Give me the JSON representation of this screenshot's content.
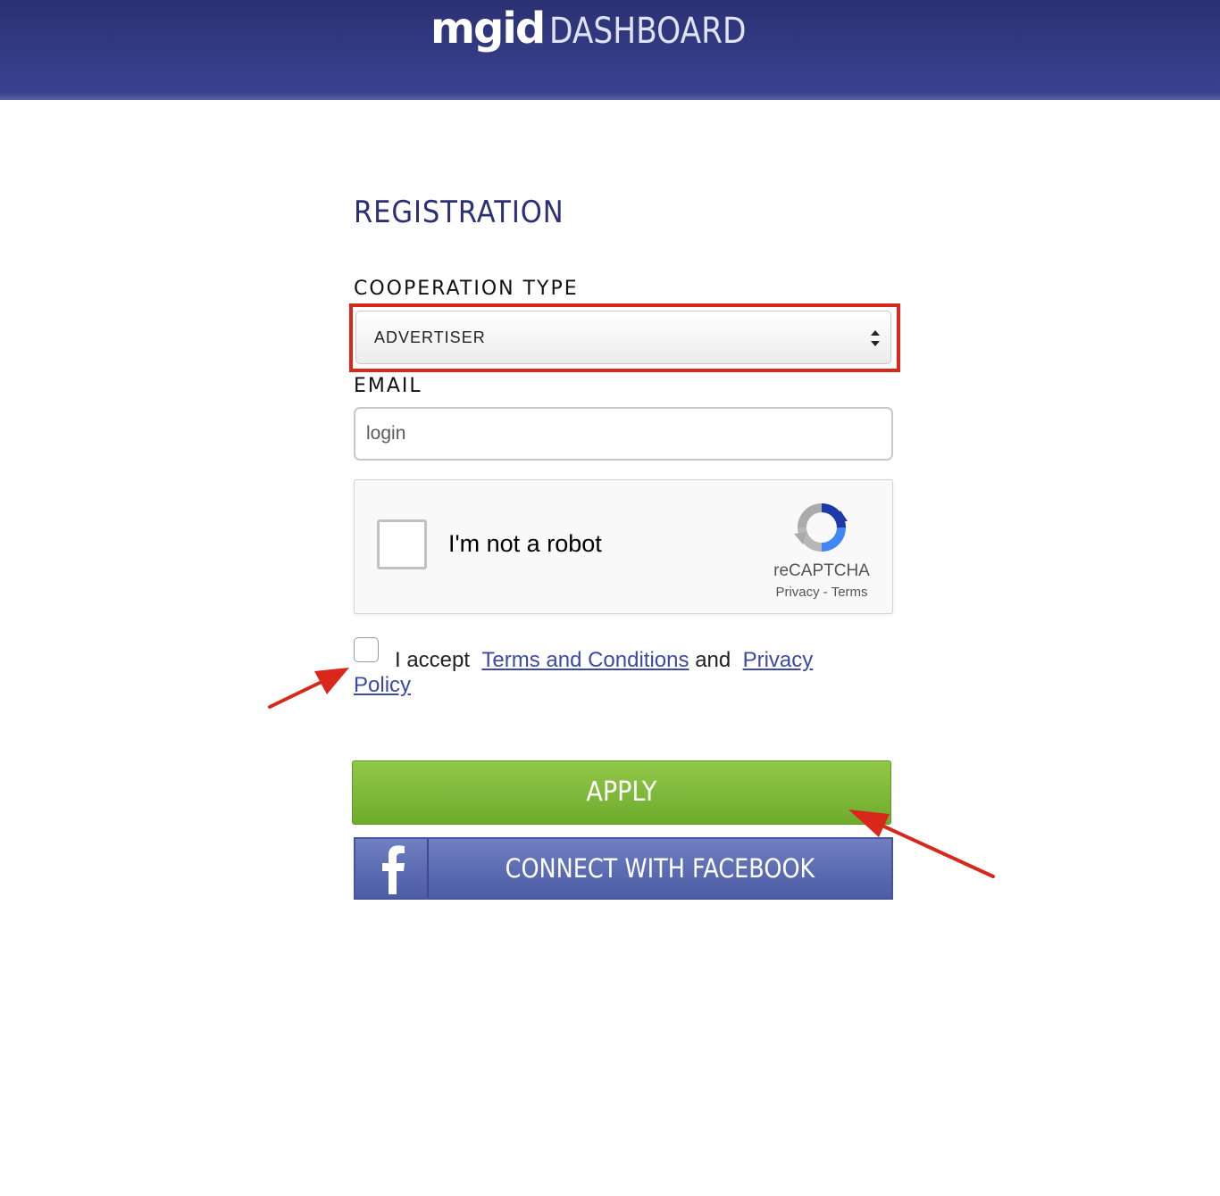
{
  "header": {
    "brand_main": "mgid",
    "brand_sub": "DASHBOARD"
  },
  "form": {
    "title": "REGISTRATION",
    "cooperation_label": "COOPERATION TYPE",
    "cooperation_value": "ADVERTISER",
    "email_label": "EMAIL",
    "email_placeholder": "login",
    "captcha_text": "I'm not a robot",
    "captcha_brand": "reCAPTCHA",
    "captcha_privacy": "Privacy",
    "captcha_sep": " - ",
    "captcha_terms": "Terms",
    "terms_prefix": "I accept",
    "terms_link": "Terms and Conditions",
    "terms_and": "and",
    "privacy_link_part1": "Privacy",
    "privacy_link_part2": "Policy",
    "apply_label": "APPLY",
    "facebook_label": "CONNECT WITH FACEBOOK"
  },
  "colors": {
    "header_bg": "#2f3678",
    "title": "#2b2f74",
    "highlight": "#d8281c",
    "apply_green": "#7cb83a",
    "facebook_blue": "#5565ad",
    "link": "#3d4aa1",
    "annotation_arrow": "#d8281c"
  },
  "icons": {
    "select_arrows": "up-down-caret-icon",
    "captcha_logo": "recaptcha-icon",
    "facebook": "facebook-icon",
    "annotation": "red-arrow-icon"
  }
}
